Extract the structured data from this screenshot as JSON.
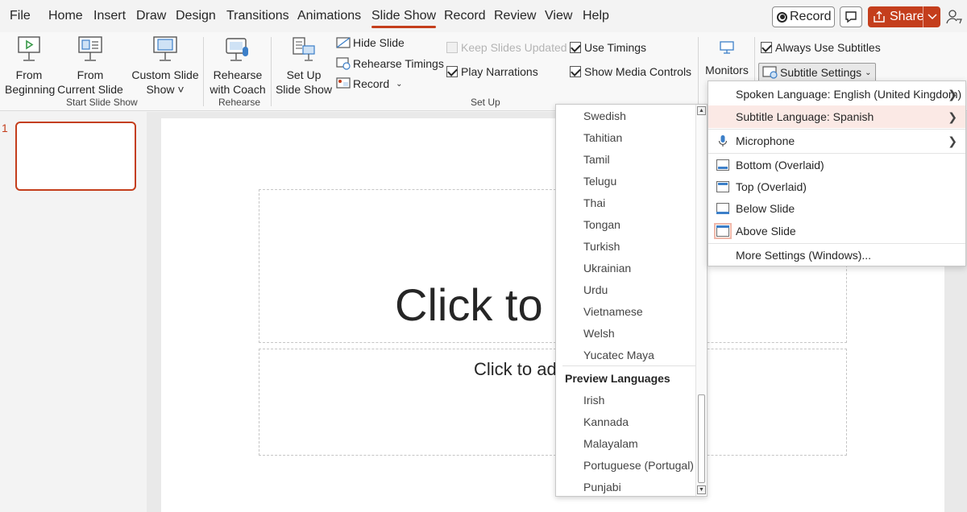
{
  "menubar": {
    "tabs": [
      "File",
      "Home",
      "Insert",
      "Draw",
      "Design",
      "Transitions",
      "Animations",
      "Slide Show",
      "Record",
      "Review",
      "View",
      "Help"
    ],
    "active_tab": "Slide Show",
    "record_label": "Record",
    "share_label": "Share"
  },
  "ribbon": {
    "start": {
      "from_beginning": [
        "From",
        "Beginning"
      ],
      "from_current": [
        "From",
        "Current Slide"
      ],
      "custom": [
        "Custom Slide",
        "Show ˅"
      ],
      "group": "Start Slide Show"
    },
    "rehearse": {
      "coach": [
        "Rehearse",
        "with Coach"
      ],
      "group": "Rehearse"
    },
    "setup": {
      "setup_show": [
        "Set Up",
        "Slide Show"
      ],
      "hide_slide": "Hide Slide",
      "rehearse_timings": "Rehearse Timings",
      "record": "Record",
      "keep_updated": "Keep Slides Updated",
      "play_narrations": "Play Narrations",
      "use_timings": "Use Timings",
      "show_media": "Show Media Controls",
      "group": "Set Up"
    },
    "monitors": "Monitors",
    "always_subtitles": "Always Use Subtitles",
    "subtitle_settings": "Subtitle Settings"
  },
  "thumbnails": {
    "slide_number": "1"
  },
  "slide": {
    "title_placeholder": "Click to a",
    "subtitle_placeholder": "Click to ad"
  },
  "language_list": {
    "languages": [
      "Swedish",
      "Tahitian",
      "Tamil",
      "Telugu",
      "Thai",
      "Tongan",
      "Turkish",
      "Ukrainian",
      "Urdu",
      "Vietnamese",
      "Welsh",
      "Yucatec Maya"
    ],
    "preview_header": "Preview Languages",
    "preview_languages": [
      "Irish",
      "Kannada",
      "Malayalam",
      "Portuguese (Portugal)",
      "Punjabi"
    ]
  },
  "subtitle_menu": {
    "spoken_language": "Spoken Language: English (United Kingdom)",
    "subtitle_language": "Subtitle Language: Spanish",
    "microphone": "Microphone",
    "bottom": "Bottom (Overlaid)",
    "top": "Top (Overlaid)",
    "below": "Below Slide",
    "above": "Above Slide",
    "more": "More Settings (Windows)..."
  },
  "colors": {
    "accent": "#c43e1c",
    "hover": "#fbe9e5",
    "icon_blue": "#3c7fc8"
  }
}
